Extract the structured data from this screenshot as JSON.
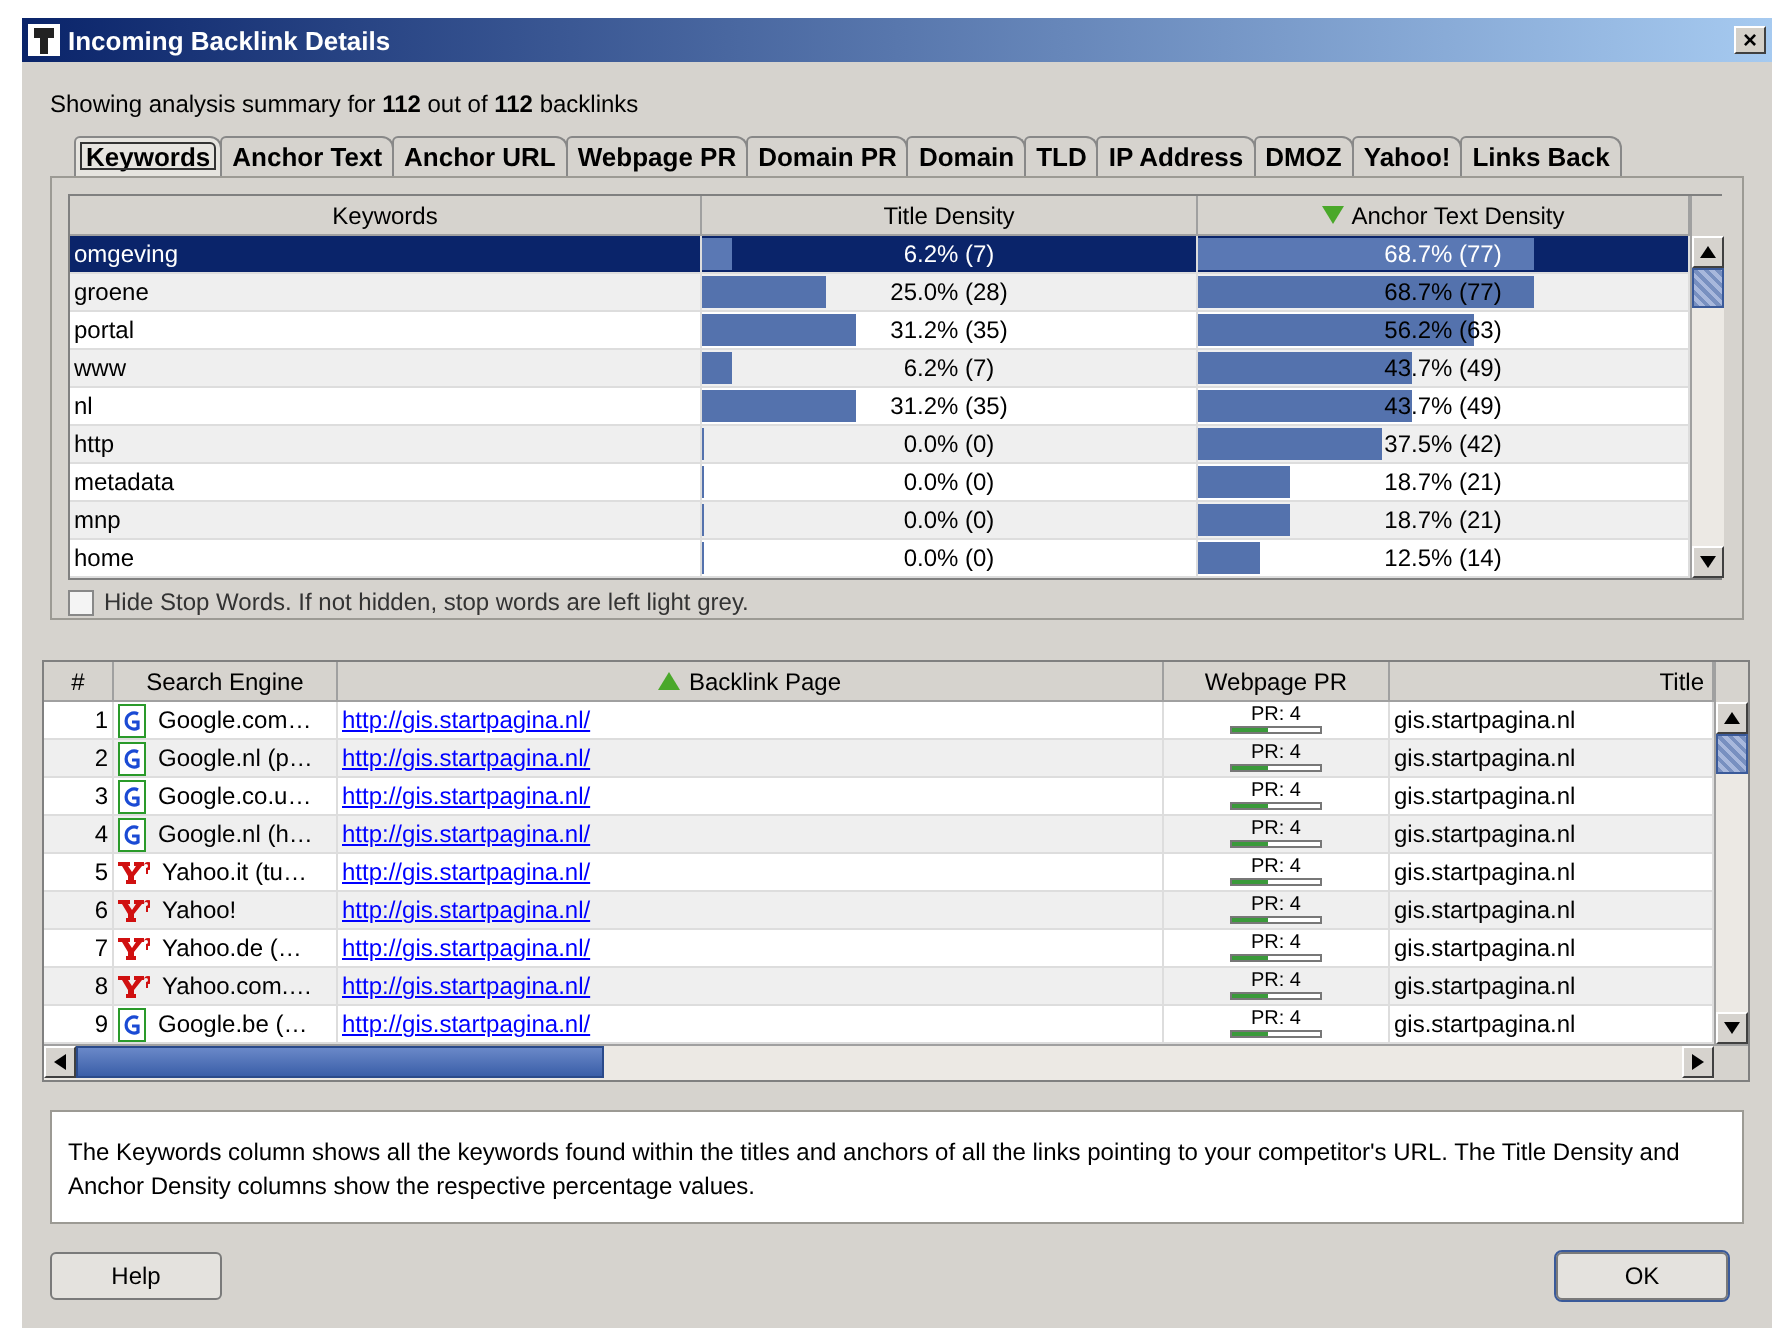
{
  "window": {
    "title": "Incoming Backlink Details",
    "close": "×"
  },
  "summary": "Showing analysis summary for **112** out of **112** backlinks",
  "tabs": [
    {
      "label": "Keywords",
      "selected": true
    },
    {
      "label": "Anchor Text",
      "selected": false
    },
    {
      "label": "Anchor URL",
      "selected": false
    },
    {
      "label": "Webpage PR",
      "selected": false
    },
    {
      "label": "Domain PR",
      "selected": false
    },
    {
      "label": "Domain",
      "selected": false
    },
    {
      "label": "TLD",
      "selected": false
    },
    {
      "label": "IP Address",
      "selected": false
    },
    {
      "label": "DMOZ",
      "selected": false
    },
    {
      "label": "Yahoo!",
      "selected": false
    },
    {
      "label": "Links Back",
      "selected": false
    }
  ],
  "keywords_table": {
    "sort_ascending": false,
    "columns": [
      {
        "label": "Keywords",
        "sorted": false
      },
      {
        "label": "Title Density",
        "sorted": false
      },
      {
        "label": "Anchor Text Density",
        "sorted": true
      }
    ],
    "rows": [
      {
        "keyword": "omgeving",
        "selected": true,
        "title_density": {
          "text": "6.2% (7)",
          "level": 0.062
        },
        "anchor_density": {
          "text": "68.7% (77)",
          "level": 0.687
        }
      },
      {
        "keyword": "groene",
        "selected": false,
        "title_density": {
          "text": "25.0% (28)",
          "level": 0.25
        },
        "anchor_density": {
          "text": "68.7% (77)",
          "level": 0.687
        }
      },
      {
        "keyword": "portal",
        "selected": false,
        "title_density": {
          "text": "31.2% (35)",
          "level": 0.312
        },
        "anchor_density": {
          "text": "56.2% (63)",
          "level": 0.562
        }
      },
      {
        "keyword": "www",
        "selected": false,
        "title_density": {
          "text": "6.2% (7)",
          "level": 0.062
        },
        "anchor_density": {
          "text": "43.7% (49)",
          "level": 0.437
        }
      },
      {
        "keyword": "nl",
        "selected": false,
        "title_density": {
          "text": "31.2% (35)",
          "level": 0.312
        },
        "anchor_density": {
          "text": "43.7% (49)",
          "level": 0.437
        }
      },
      {
        "keyword": "http",
        "selected": false,
        "title_density": {
          "text": "0.0% (0)",
          "level": 0
        },
        "anchor_density": {
          "text": "37.5% (42)",
          "level": 0.375
        }
      },
      {
        "keyword": "metadata",
        "selected": false,
        "title_density": {
          "text": "0.0% (0)",
          "level": 0
        },
        "anchor_density": {
          "text": "18.7% (21)",
          "level": 0.187
        }
      },
      {
        "keyword": "mnp",
        "selected": false,
        "title_density": {
          "text": "0.0% (0)",
          "level": 0
        },
        "anchor_density": {
          "text": "18.7% (21)",
          "level": 0.187
        }
      },
      {
        "keyword": "home",
        "selected": false,
        "title_density": {
          "text": "0.0% (0)",
          "level": 0
        },
        "anchor_density": {
          "text": "12.5% (14)",
          "level": 0.125
        }
      }
    ]
  },
  "hide_stop_words": {
    "label": "Hide Stop Words. If not hidden, stop words are left light grey.",
    "checked": false
  },
  "backlinks_table": {
    "sort_ascending": true,
    "columns": [
      {
        "label": "#",
        "sorted": false
      },
      {
        "label": "Search Engine",
        "sorted": false
      },
      {
        "label": "Backlink Page",
        "sorted": true
      },
      {
        "label": "Webpage PR",
        "sorted": false
      },
      {
        "label": "Title",
        "sorted": false
      }
    ],
    "rows": [
      {
        "number": "1",
        "engine": {
          "kind": "google",
          "name": "Google.com…"
        },
        "page": "http://gis.startpagina.nl/",
        "pr": {
          "text": "PR: 4",
          "level": 0.4
        },
        "title": "gis.startpagina.nl"
      },
      {
        "number": "2",
        "engine": {
          "kind": "google",
          "name": "Google.nl (p…"
        },
        "page": "http://gis.startpagina.nl/",
        "pr": {
          "text": "PR: 4",
          "level": 0.4
        },
        "title": "gis.startpagina.nl"
      },
      {
        "number": "3",
        "engine": {
          "kind": "google",
          "name": "Google.co.u…"
        },
        "page": "http://gis.startpagina.nl/",
        "pr": {
          "text": "PR: 4",
          "level": 0.4
        },
        "title": "gis.startpagina.nl"
      },
      {
        "number": "4",
        "engine": {
          "kind": "google",
          "name": "Google.nl (h…"
        },
        "page": "http://gis.startpagina.nl/",
        "pr": {
          "text": "PR: 4",
          "level": 0.4
        },
        "title": "gis.startpagina.nl"
      },
      {
        "number": "5",
        "engine": {
          "kind": "yahoo",
          "name": "Yahoo.it (tu…"
        },
        "page": "http://gis.startpagina.nl/",
        "pr": {
          "text": "PR: 4",
          "level": 0.4
        },
        "title": "gis.startpagina.nl"
      },
      {
        "number": "6",
        "engine": {
          "kind": "yahoo",
          "name": "Yahoo!"
        },
        "page": "http://gis.startpagina.nl/",
        "pr": {
          "text": "PR: 4",
          "level": 0.4
        },
        "title": "gis.startpagina.nl"
      },
      {
        "number": "7",
        "engine": {
          "kind": "yahoo",
          "name": "Yahoo.de (…"
        },
        "page": "http://gis.startpagina.nl/",
        "pr": {
          "text": "PR: 4",
          "level": 0.4
        },
        "title": "gis.startpagina.nl"
      },
      {
        "number": "8",
        "engine": {
          "kind": "yahoo",
          "name": "Yahoo.com.…"
        },
        "page": "http://gis.startpagina.nl/",
        "pr": {
          "text": "PR: 4",
          "level": 0.4
        },
        "title": "gis.startpagina.nl"
      },
      {
        "number": "9",
        "engine": {
          "kind": "google",
          "name": "Google.be (…"
        },
        "page": "http://gis.startpagina.nl/",
        "pr": {
          "text": "PR: 4",
          "level": 0.4
        },
        "title": "gis.startpagina.nl"
      }
    ]
  },
  "description": "The Keywords column shows all the keywords found within the titles and anchors of all the links pointing to your competitor's URL. The Title Density and Anchor Density columns show the respective percentage values.",
  "buttons": [
    {
      "label": "Help",
      "kind": "normal"
    },
    {
      "label": "OK",
      "kind": "default"
    }
  ]
}
